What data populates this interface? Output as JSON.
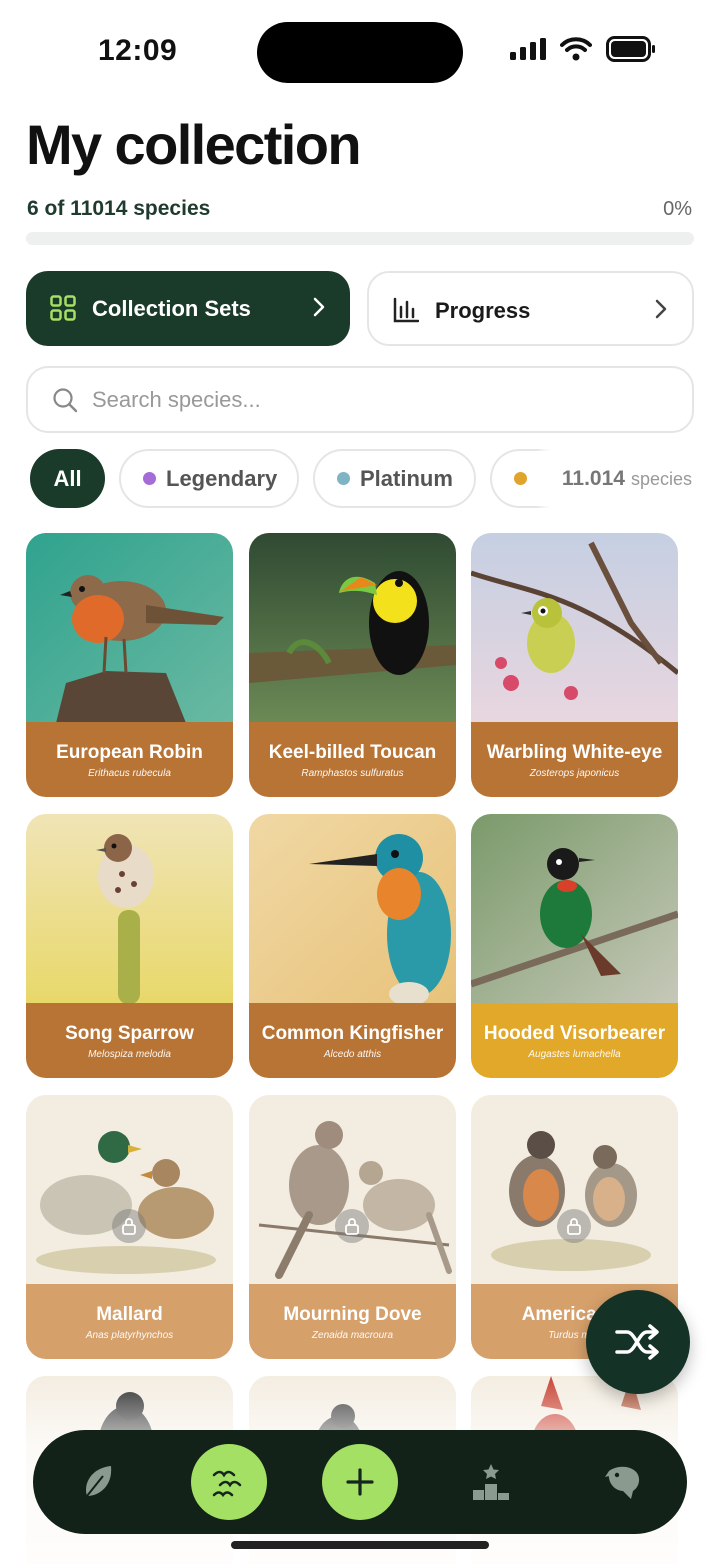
{
  "status": {
    "time": "12:09"
  },
  "header": {
    "title": "My collection",
    "species_count": "6 of 11014 species",
    "percent": "0%",
    "progress_fraction": 0
  },
  "actions": {
    "collection_sets_label": "Collection Sets",
    "progress_label": "Progress"
  },
  "search": {
    "placeholder": "Search species..."
  },
  "filters": [
    {
      "label": "All",
      "dot_color": ""
    },
    {
      "label": "Legendary",
      "dot_color": "#a56bd6"
    },
    {
      "label": "Platinum",
      "dot_color": "#7fb4c4"
    },
    {
      "label": "",
      "dot_color": "#e0a42c"
    }
  ],
  "species_total": {
    "number": "11.014",
    "unit": "species"
  },
  "cards": [
    {
      "name": "European Robin",
      "sci": "Erithacus rubecula",
      "tier": "copper",
      "locked": false
    },
    {
      "name": "Keel-billed Toucan",
      "sci": "Ramphastos sulfuratus",
      "tier": "copper",
      "locked": false
    },
    {
      "name": "Warbling White-eye",
      "sci": "Zosterops japonicus",
      "tier": "copper",
      "locked": false
    },
    {
      "name": "Song Sparrow",
      "sci": "Melospiza melodia",
      "tier": "copper",
      "locked": false
    },
    {
      "name": "Common Kingfisher",
      "sci": "Alcedo atthis",
      "tier": "copper",
      "locked": false
    },
    {
      "name": "Hooded Visorbearer",
      "sci": "Augastes lumachella",
      "tier": "gold",
      "locked": false
    },
    {
      "name": "Mallard",
      "sci": "Anas platyrhynchos",
      "tier": "locked",
      "locked": true
    },
    {
      "name": "Mourning Dove",
      "sci": "Zenaida macroura",
      "tier": "locked",
      "locked": true
    },
    {
      "name": "American R",
      "sci": "Turdus migr",
      "tier": "locked",
      "locked": true
    }
  ],
  "colors": {
    "primary": "#1a3a2a",
    "accent_green": "#a4e063",
    "copper": "#b87434",
    "gold": "#e2a829",
    "locked": "#d6a06b"
  },
  "tabbar": {
    "icons": [
      "feather-icon",
      "flock-icon",
      "plus-icon",
      "leaderboard-icon",
      "eagle-icon"
    ]
  }
}
